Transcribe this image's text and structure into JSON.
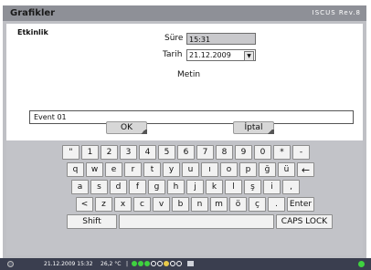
{
  "window": {
    "title": "Grafikler",
    "brand": "ISCUS Rev.8"
  },
  "form": {
    "section_label": "Etkinlik",
    "sure_label": "Süre",
    "sure_value": "15:31",
    "tarih_label": "Tarih",
    "tarih_value": "21.12.2009",
    "dropdown_glyph": "▼",
    "metin_label": "Metin",
    "text_value": "Event 01",
    "ok_label": "OK",
    "cancel_label": "İptal"
  },
  "keyboard": {
    "row1": [
      "\"",
      "1",
      "2",
      "3",
      "4",
      "5",
      "6",
      "7",
      "8",
      "9",
      "0",
      "*",
      "-"
    ],
    "row2": [
      "q",
      "w",
      "e",
      "r",
      "t",
      "y",
      "u",
      "ı",
      "o",
      "p",
      "ğ",
      "ü",
      "←"
    ],
    "row3": [
      "a",
      "s",
      "d",
      "f",
      "g",
      "h",
      "j",
      "k",
      "l",
      "ş",
      "i",
      ","
    ],
    "row4": [
      "<",
      "z",
      "x",
      "c",
      "v",
      "b",
      "n",
      "m",
      "ö",
      "ç",
      ".",
      "Enter"
    ],
    "row5": [
      "Shift",
      "",
      "CAPS LOCK"
    ]
  },
  "status": {
    "datetime": "21.12.2009 15:32",
    "temperature": "26,2 °C"
  },
  "colors": {
    "accent_green": "#3fd23f",
    "titlebar": "#8e9097",
    "statusbar": "#3a3e4f"
  }
}
